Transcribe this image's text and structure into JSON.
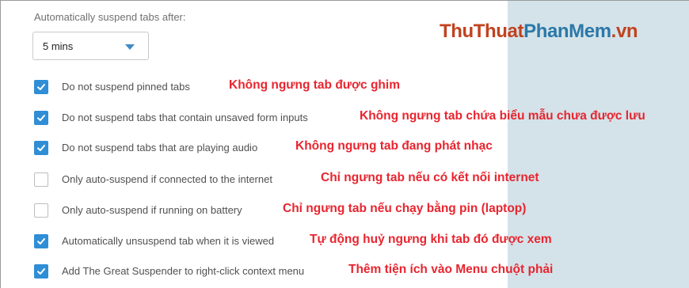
{
  "settings": {
    "heading": "Automatically suspend tabs after:",
    "suspend_select": {
      "value": "5 mins"
    }
  },
  "options": [
    {
      "label": "Do not suspend pinned tabs",
      "checked": true,
      "annotation": "Không ngưng tab được ghim"
    },
    {
      "label": "Do not suspend tabs that contain unsaved form inputs",
      "checked": true,
      "annotation": "Không ngưng tab chứa biểu mẫu chưa được lưu"
    },
    {
      "label": "Do not suspend tabs that are playing audio",
      "checked": true,
      "annotation": "Không ngưng tab đang phát nhạc"
    },
    {
      "label": "Only auto-suspend if connected to the internet",
      "checked": false,
      "annotation": "Chỉ ngưng tab nếu có kết nối internet"
    },
    {
      "label": "Only auto-suspend if running on battery",
      "checked": false,
      "annotation": "Chỉ ngưng tab nếu chạy bằng pin (laptop)"
    },
    {
      "label": "Automatically unsuspend tab when it is viewed",
      "checked": true,
      "annotation": "Tự động huỷ ngưng khi tab đó được xem"
    },
    {
      "label": "Add The Great Suspender to right-click context menu",
      "checked": true,
      "annotation": "Thêm tiện ích vào Menu chuột phải"
    }
  ],
  "watermark": {
    "part1": "ThuThuat",
    "part2": "PhanMem",
    "part3": ".vn"
  },
  "colors": {
    "checkbox_checked": "#2f8ed6",
    "annotation_text": "#e8252f",
    "side_panel": "#d4e3e9",
    "watermark_orange": "#c2421f",
    "watermark_blue": "#2b78a8"
  }
}
